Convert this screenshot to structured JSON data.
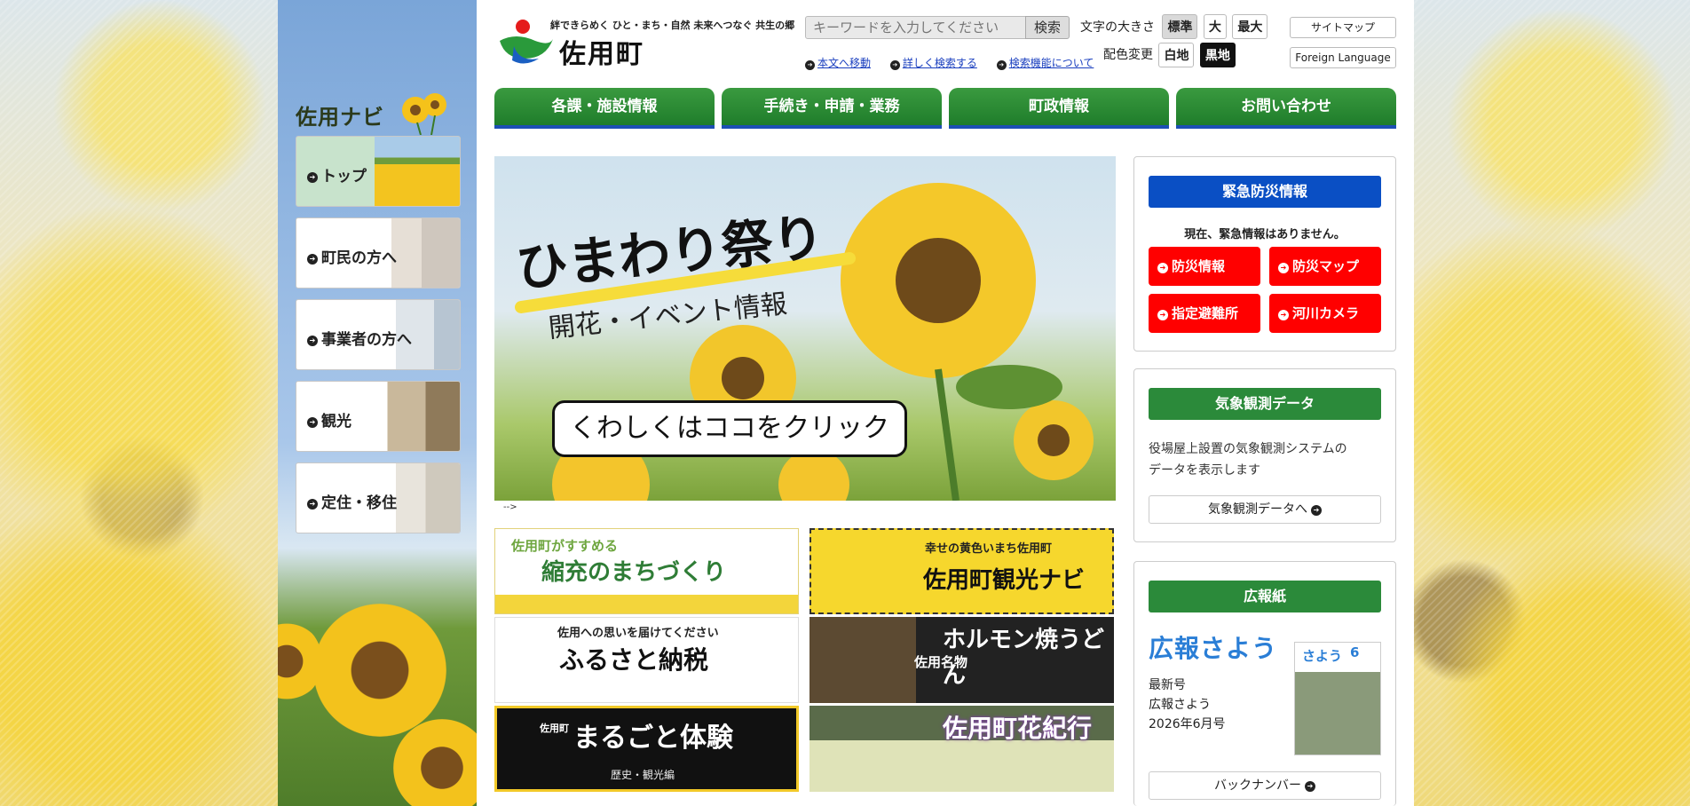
{
  "site": {
    "tagline": "絆できらめく ひと・まち・自然 未来へつなぐ 共生の郷",
    "name": "佐用町"
  },
  "search": {
    "placeholder": "キーワードを入力してください",
    "button": "検索",
    "links": [
      "本文へ移動",
      "詳しく検索する",
      "検索機能について"
    ]
  },
  "font_size": {
    "label": "文字の大きさ",
    "options": [
      "標準",
      "大",
      "最大"
    ]
  },
  "color_scheme": {
    "label": "配色変更",
    "options": [
      "白地",
      "黒地"
    ]
  },
  "header_buttons": {
    "sitemap": "サイトマップ",
    "foreign": "Foreign Language"
  },
  "global_nav": [
    "各課・施設情報",
    "手続き・申請・業務",
    "町政情報",
    "お問い合わせ"
  ],
  "side_nav": {
    "title": "佐用ナビ",
    "items": [
      "トップ",
      "町民の方へ",
      "事業者の方へ",
      "観光",
      "定住・移住"
    ]
  },
  "banner": {
    "title": "ひまわり祭り",
    "subtitle": "開花・イベント情報",
    "cta": "くわしくはココをクリック"
  },
  "comment_text": "-->",
  "tiles": {
    "t1_small": "佐用町がすすめる",
    "t1_big": "縮充のまちづくり",
    "t2_small": "幸せの黄色いまち佐用町",
    "t2_big": "佐用町観光ナビ",
    "t3_small": "佐用への思いを届けてください",
    "t3_big": "ふるさと納税",
    "t4_small": "佐用名物",
    "t4_big": "ホルモン焼うどん",
    "t5_small": "佐用町",
    "t5_big": "まるごと体験",
    "t5_sub": "歴史・観光編",
    "t6_big": "佐用町花紀行"
  },
  "emergency": {
    "title": "緊急防災情報",
    "message": "現在、緊急情報はありません。",
    "buttons": [
      "防災情報",
      "防災マップ",
      "指定避難所",
      "河川カメラ"
    ]
  },
  "weather": {
    "title": "気象観測データ",
    "desc_line1": "役場屋上設置の気象観測システムの",
    "desc_line2": "データを表示します",
    "link": "気象観測データへ"
  },
  "koho": {
    "title": "広報紙",
    "logo": "広報さよう",
    "latest_label": "最新号",
    "name": "広報さよう",
    "issue": "2026年6月号",
    "cover_title": "さよう",
    "cover_num": "6",
    "back_numbers": "バックナンバー"
  },
  "colors": {
    "green": "#1f7d2b",
    "blue": "#0a4fc4",
    "red": "#ff0000"
  }
}
